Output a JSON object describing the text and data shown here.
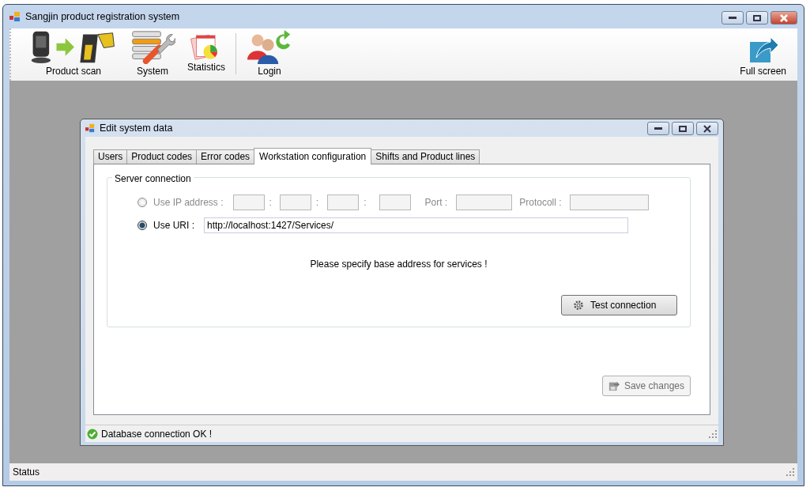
{
  "window": {
    "title": "Sangjin product registration system"
  },
  "toolbar": {
    "items": [
      {
        "label": "Product scan",
        "kind": "scan",
        "separator_after": false
      },
      {
        "label": "System",
        "kind": "system",
        "separator_after": false
      },
      {
        "label": "Statistics",
        "kind": "stats",
        "separator_after": true
      },
      {
        "label": "Login",
        "kind": "login",
        "separator_after": false
      }
    ],
    "right_item": {
      "label": "Full screen"
    }
  },
  "child_window": {
    "title": "Edit system data",
    "tabs": [
      {
        "label": "Users",
        "selected": false
      },
      {
        "label": "Product codes",
        "selected": false
      },
      {
        "label": "Error codes",
        "selected": false
      },
      {
        "label": "Workstation configuration",
        "selected": true
      },
      {
        "label": "Shifts and Product lines",
        "selected": false
      }
    ],
    "group": {
      "title": "Server connection",
      "ip_option": {
        "label": "Use IP address :",
        "selected": false,
        "disabled": true,
        "separators": [
          ":",
          ":",
          ":"
        ],
        "port_label": "Port :",
        "protocol_label": "Protocoll :"
      },
      "uri_option": {
        "label": "Use URI :",
        "selected": true,
        "value": "http://localhost:1427/Services/"
      },
      "message": "Please specify base address for services !",
      "test_button": {
        "label": "Test connection"
      }
    },
    "save_button": {
      "label": "Save changes",
      "disabled": true
    },
    "status": "Database connection OK !"
  },
  "status_bar": "Status"
}
